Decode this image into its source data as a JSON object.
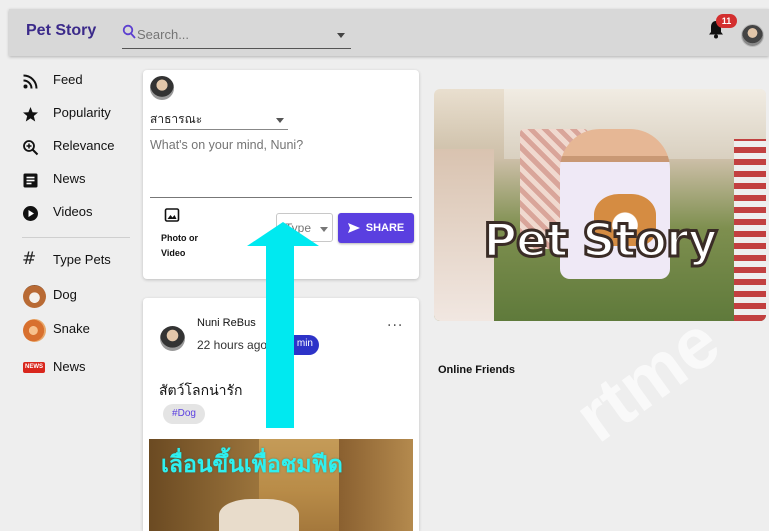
{
  "header": {
    "brand": "Pet Story",
    "search_placeholder": "Search...",
    "notification_count": "11"
  },
  "sidebar": {
    "items": [
      {
        "label": "Feed",
        "icon": "rss-icon"
      },
      {
        "label": "Popularity",
        "icon": "star-icon"
      },
      {
        "label": "Relevance",
        "icon": "zoom-in-icon"
      },
      {
        "label": "News",
        "icon": "article-icon"
      },
      {
        "label": "Videos",
        "icon": "play-circle-icon"
      }
    ],
    "section_title": "Type Pets",
    "pet_types": [
      {
        "label": "Dog",
        "icon": "dog-avatar"
      },
      {
        "label": "Snake",
        "icon": "snake-avatar"
      },
      {
        "label": "News",
        "icon": "news-badge",
        "badge_text": "NEWS"
      }
    ]
  },
  "composer": {
    "audience": "สาธารณะ",
    "placeholder": "What's on your mind, Nuni?",
    "photo_label": "Photo or\nVideo",
    "type_placeholder": "Type",
    "share_label": "SHARE",
    "accent": "#5a3fe0"
  },
  "post": {
    "author": "Nuni ReBus",
    "time": "22 hours ago",
    "role": "min",
    "more": "···",
    "text": "สัตว์โลกน่ารัก",
    "tag": "#Dog"
  },
  "overlay": {
    "swipe_hint": "เลื่อนขึ้นเพื่อชมฟีด",
    "arrow_color": "#00e9f0"
  },
  "banner": {
    "title": "Pet Story"
  },
  "online_friends": {
    "title": "Online Friends"
  },
  "watermark": "rtme"
}
